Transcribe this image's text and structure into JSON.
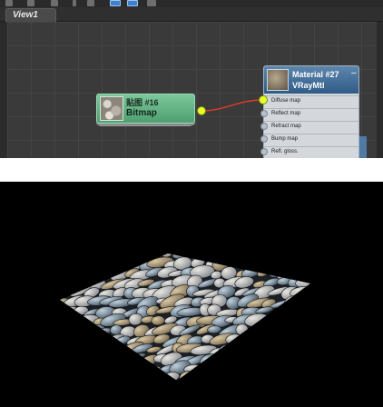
{
  "toolbar": {
    "icons": [
      "tool-icon",
      "grid-icon",
      "layout-icon",
      "cursor-icon",
      "pick-icon",
      "active-view-icon",
      "save-icon",
      "options-icon"
    ]
  },
  "view_tab": {
    "label": "View1"
  },
  "bitmap_node": {
    "title": "贴图 #16",
    "type": "Bitmap",
    "accent": "#5fb080"
  },
  "material_node": {
    "title": "Material #27",
    "type": "VRayMtl",
    "collapse": "–",
    "header_color": "#3f6c98",
    "slots": [
      "Diffuse map",
      "Reflect map",
      "Refract map",
      "Bump map",
      "Refl. gloss."
    ]
  },
  "wire": {
    "color": "#e03a2e"
  },
  "render": {
    "background": "#000000",
    "subject": "pebble-texture-plane"
  }
}
